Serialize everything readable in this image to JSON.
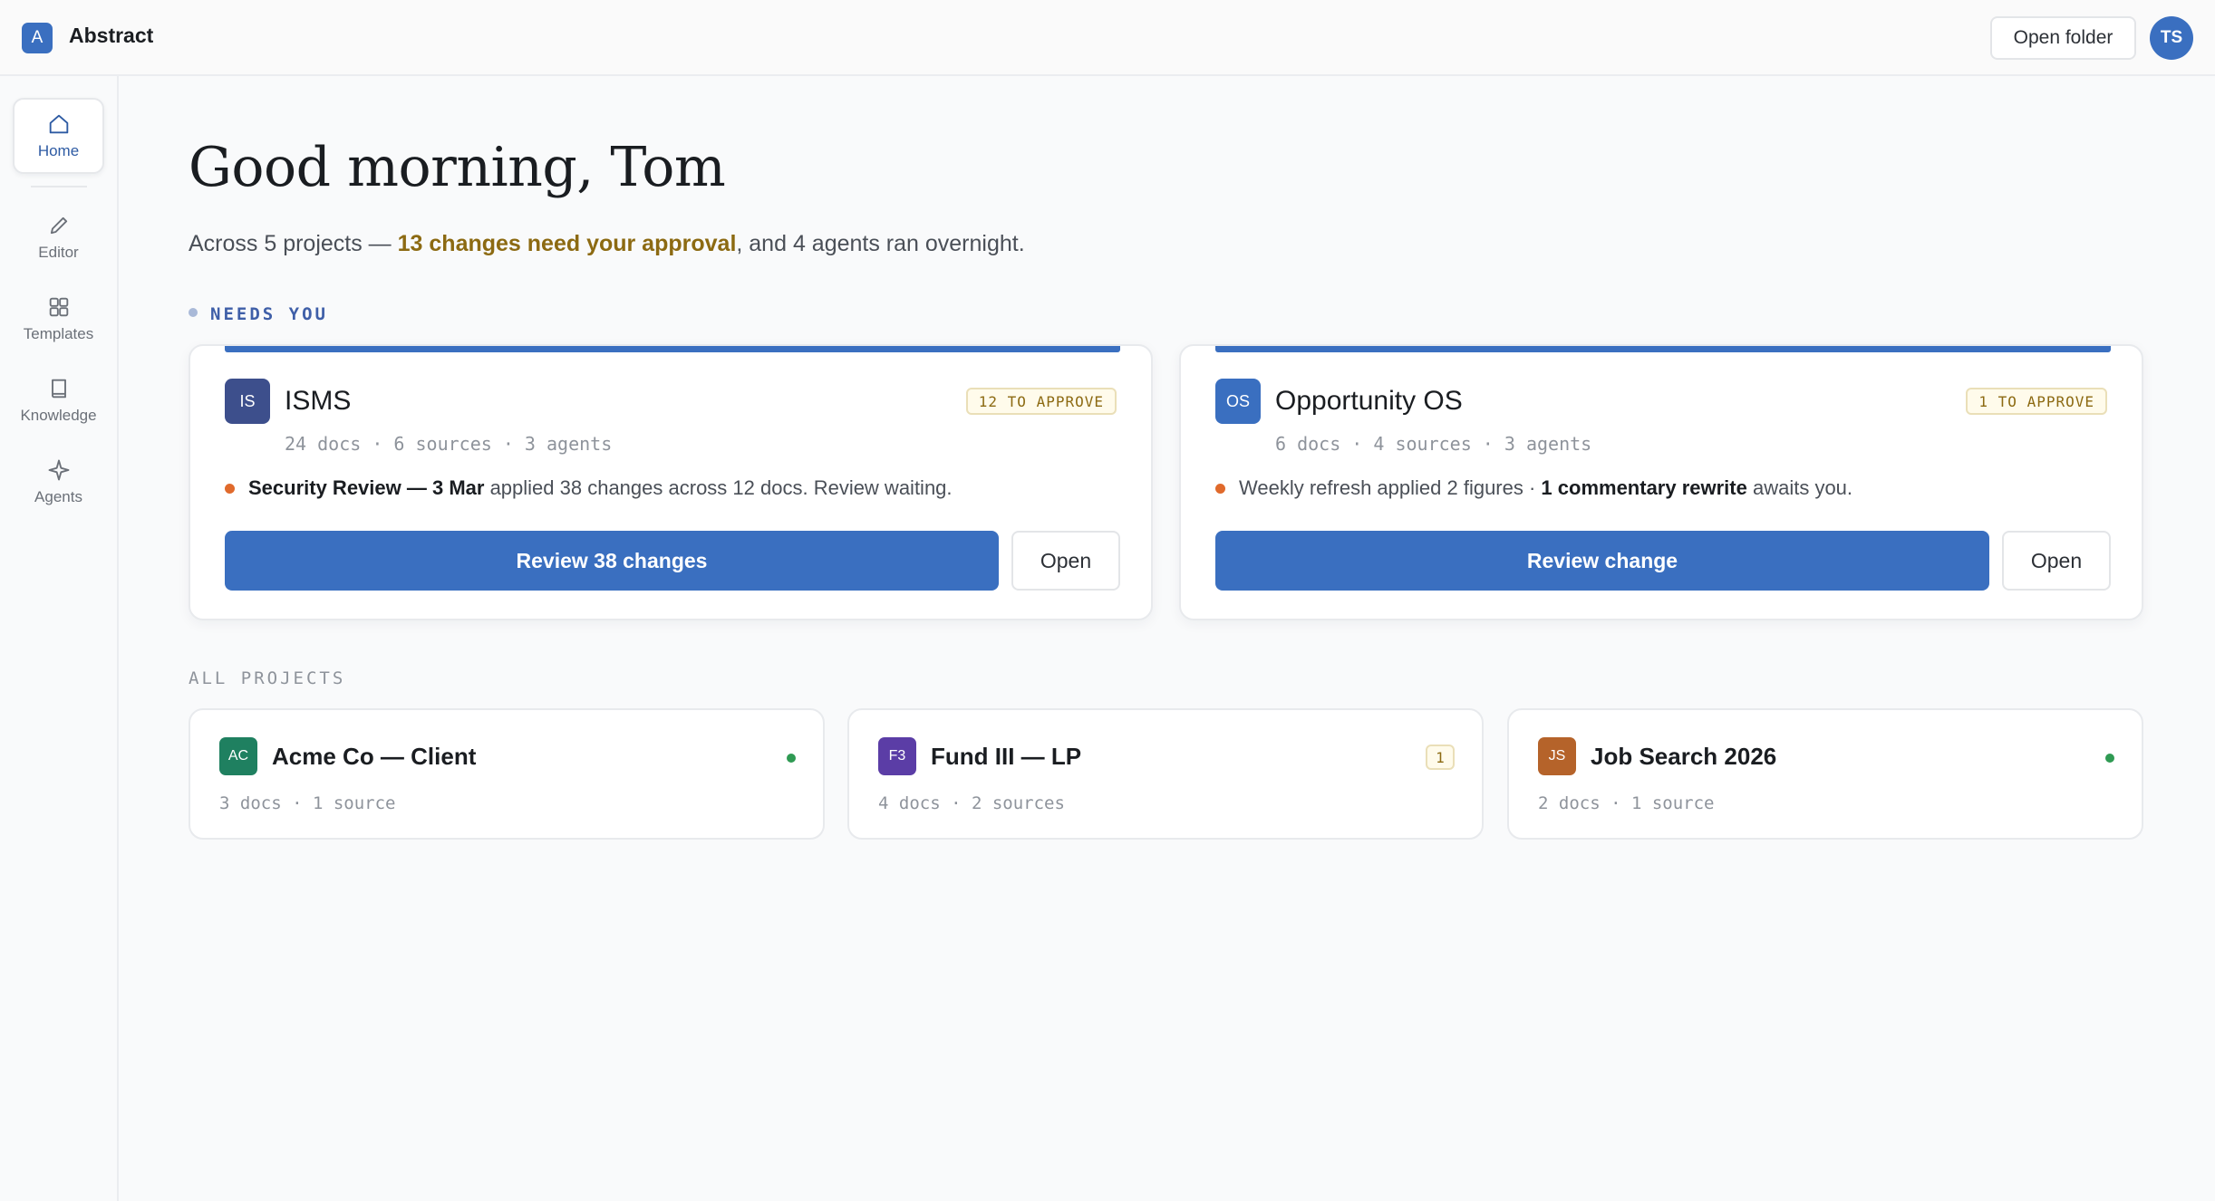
{
  "app": {
    "logo_letter": "A",
    "title": "Abstract"
  },
  "header": {
    "open_folder_label": "Open folder",
    "avatar_initials": "TS"
  },
  "sidebar": {
    "items": [
      {
        "label": "Home",
        "icon": "home-icon",
        "active": true
      },
      {
        "label": "Editor",
        "icon": "pencil-icon",
        "active": false
      },
      {
        "label": "Templates",
        "icon": "grid-icon",
        "active": false
      },
      {
        "label": "Knowledge",
        "icon": "book-icon",
        "active": false
      },
      {
        "label": "Agents",
        "icon": "sparkle-icon",
        "active": false
      }
    ]
  },
  "main": {
    "greeting": "Good morning, Tom",
    "subline_prefix": "Across 5 projects — ",
    "subline_highlight": "13 changes need your approval",
    "subline_suffix": ", and 4 agents ran overnight.",
    "needs_you_label": "NEEDS YOU",
    "all_projects_label": "ALL PROJECTS"
  },
  "needs_you": [
    {
      "initials": "IS",
      "badge_color": "#3d4f8c",
      "name": "ISMS",
      "approve_badge": "12 TO APPROVE",
      "meta": "24 docs · 6 sources · 3 agents",
      "desc_bold": "Security Review — 3 Mar",
      "desc_rest": " applied 38 changes across 12 docs. Review waiting.",
      "primary_label": "Review 38 changes",
      "open_label": "Open"
    },
    {
      "initials": "OS",
      "badge_color": "#3a6fc0",
      "name": "Opportunity OS",
      "approve_badge": "1 TO APPROVE",
      "meta": "6 docs · 4 sources · 3 agents",
      "desc_pre": "Weekly refresh applied 2 figures · ",
      "desc_bold": "1 commentary rewrite",
      "desc_rest": " awaits you.",
      "primary_label": "Review change",
      "open_label": "Open"
    }
  ],
  "all_projects": [
    {
      "initials": "AC",
      "badge_color": "#1f8060",
      "name": "Acme Co — Client",
      "meta": "3 docs · 1 source",
      "status": "green-dot"
    },
    {
      "initials": "F3",
      "badge_color": "#5b3da6",
      "name": "Fund III — LP",
      "meta": "4 docs · 2 sources",
      "count": "1"
    },
    {
      "initials": "JS",
      "badge_color": "#b5632a",
      "name": "Job Search 2026",
      "meta": "2 docs · 1 source",
      "status": "green-dot"
    }
  ],
  "colors": {
    "accent": "#3a6fc0",
    "approval": "#8c6a12",
    "alert_dot": "#e06a2c",
    "ok_dot": "#2f9a53"
  }
}
